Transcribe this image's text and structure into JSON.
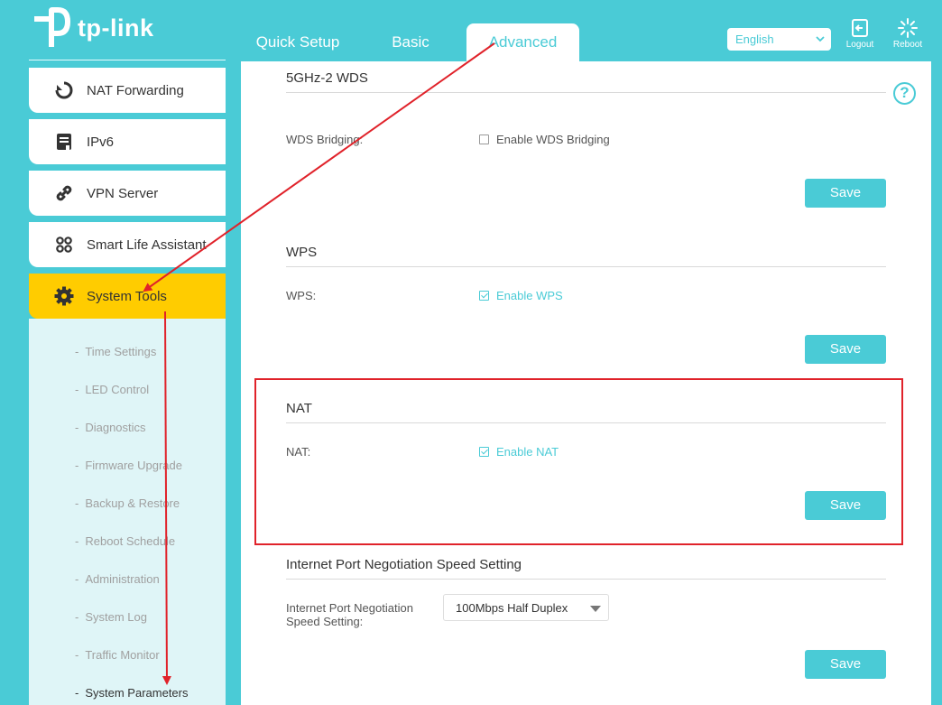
{
  "header": {
    "brand": "tp-link",
    "tabs": [
      {
        "label": "Quick Setup"
      },
      {
        "label": "Basic"
      },
      {
        "label": "Advanced"
      }
    ],
    "language": "English",
    "logout_label": "Logout",
    "reboot_label": "Reboot",
    "accent_color": "#4acbd6"
  },
  "sidebar": {
    "items": [
      {
        "label": "NAT Forwarding",
        "icon": "nat-forwarding-icon"
      },
      {
        "label": "IPv6",
        "icon": "ipv6-icon"
      },
      {
        "label": "VPN Server",
        "icon": "vpn-link-icon"
      },
      {
        "label": "Smart Life Assistant",
        "icon": "smart-life-icon"
      },
      {
        "label": "System Tools",
        "icon": "gear-icon",
        "active": true
      }
    ],
    "submenu": [
      {
        "label": "Time Settings"
      },
      {
        "label": "LED Control"
      },
      {
        "label": "Diagnostics"
      },
      {
        "label": "Firmware Upgrade"
      },
      {
        "label": "Backup & Restore"
      },
      {
        "label": "Reboot Schedule"
      },
      {
        "label": "Administration"
      },
      {
        "label": "System Log"
      },
      {
        "label": "Traffic Monitor"
      },
      {
        "label": "System Parameters",
        "active": true
      }
    ],
    "dash": "-",
    "active_color": "#ffcc00"
  },
  "content": {
    "help_symbol": "?",
    "sections": {
      "wds": {
        "title": "5GHz-2 WDS",
        "field_label": "WDS Bridging:",
        "checkbox_label": "Enable WDS Bridging",
        "checked": false,
        "save_label": "Save"
      },
      "wps": {
        "title": "WPS",
        "field_label": "WPS:",
        "checkbox_label": "Enable WPS",
        "checked": true,
        "save_label": "Save"
      },
      "nat": {
        "title": "NAT",
        "field_label": "NAT:",
        "checkbox_label": "Enable NAT",
        "checked": true,
        "save_label": "Save"
      },
      "speed": {
        "title": "Internet Port Negotiation Speed Setting",
        "field_label_line1": "Internet Port Negotiation",
        "field_label_line2": "Speed Setting:",
        "selected": "100Mbps Half Duplex",
        "save_label": "Save"
      }
    }
  },
  "annotation": {
    "color": "#e0222a"
  }
}
